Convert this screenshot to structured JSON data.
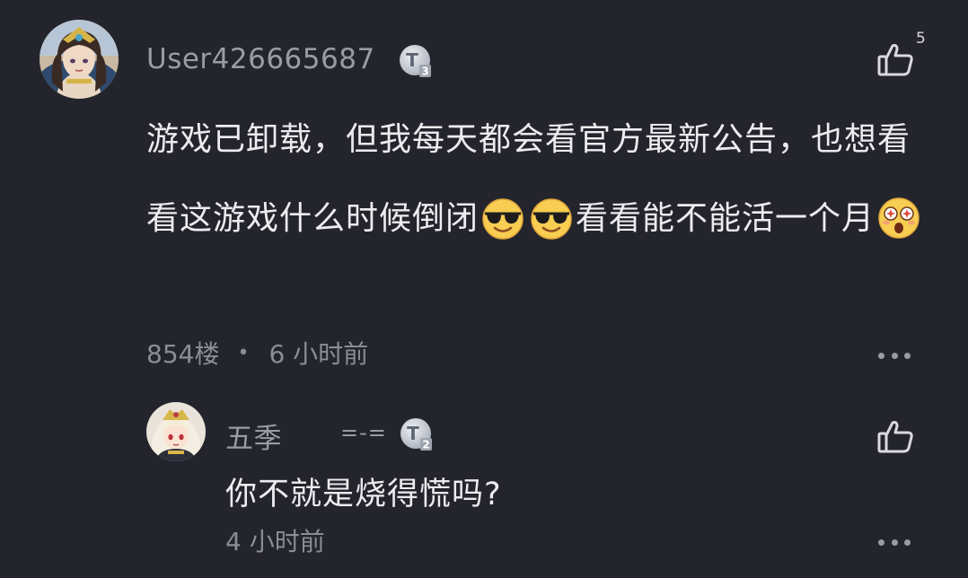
{
  "main_comment": {
    "username": "User426665687",
    "level_badge": "T3",
    "like_count": "5",
    "text_parts": [
      "游戏已卸载，但我每天都会看官方最新公告，也想看看这游戏什么时候倒闭",
      "看看能不能活一个月"
    ],
    "emojis": [
      "sunglasses-emoji",
      "sunglasses-emoji",
      "astonished-emoji"
    ],
    "floor": "854楼",
    "separator": "•",
    "time": "6 小时前",
    "icons": {
      "like": "thumbs-up-icon",
      "more": "more-icon"
    }
  },
  "reply": {
    "username": "五季",
    "tag": "=-=",
    "level_badge": "T2",
    "text": "你不就是烧得慌吗?",
    "time": "4 小时前",
    "icons": {
      "like": "thumbs-up-icon",
      "more": "more-icon"
    }
  },
  "colors": {
    "background": "#24252c",
    "primary_text": "#ececf0",
    "secondary_text": "#8b8c94",
    "badge": "#c9ccd4"
  }
}
